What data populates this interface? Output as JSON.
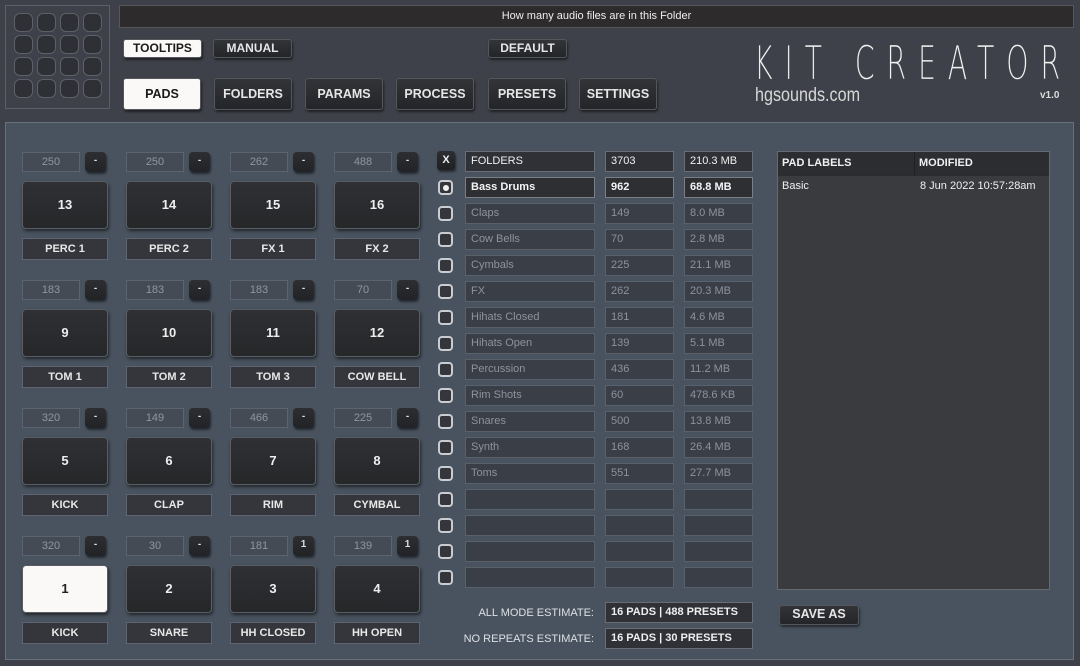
{
  "header": {
    "info_text": "How many audio files are in this Folder",
    "title": "KIT CREATOR",
    "site": "hgsounds.com",
    "version": "v1.0",
    "buttons": {
      "tooltips": "TOOLTIPS",
      "manual": "MANUAL",
      "default": "DEFAULT"
    },
    "tabs": [
      {
        "label": "PADS",
        "active": true
      },
      {
        "label": "FOLDERS",
        "active": false
      },
      {
        "label": "PARAMS",
        "active": false
      },
      {
        "label": "PROCESS",
        "active": false
      },
      {
        "label": "PRESETS",
        "active": false
      },
      {
        "label": "SETTINGS",
        "active": false
      }
    ]
  },
  "pads": [
    {
      "number": "13",
      "count": "250",
      "mode": "-",
      "label": "PERC 1"
    },
    {
      "number": "14",
      "count": "250",
      "mode": "-",
      "label": "PERC 2"
    },
    {
      "number": "15",
      "count": "262",
      "mode": "-",
      "label": "FX 1"
    },
    {
      "number": "16",
      "count": "488",
      "mode": "-",
      "label": "FX 2"
    },
    {
      "number": "9",
      "count": "183",
      "mode": "-",
      "label": "TOM 1"
    },
    {
      "number": "10",
      "count": "183",
      "mode": "-",
      "label": "TOM 2"
    },
    {
      "number": "11",
      "count": "183",
      "mode": "-",
      "label": "TOM 3"
    },
    {
      "number": "12",
      "count": "70",
      "mode": "-",
      "label": "COW BELL"
    },
    {
      "number": "5",
      "count": "320",
      "mode": "-",
      "label": "KICK"
    },
    {
      "number": "6",
      "count": "149",
      "mode": "-",
      "label": "CLAP"
    },
    {
      "number": "7",
      "count": "466",
      "mode": "-",
      "label": "RIM"
    },
    {
      "number": "8",
      "count": "225",
      "mode": "-",
      "label": "CYMBAL"
    },
    {
      "number": "1",
      "count": "320",
      "mode": "-",
      "label": "KICK",
      "active": true
    },
    {
      "number": "2",
      "count": "30",
      "mode": "-",
      "label": "SNARE"
    },
    {
      "number": "3",
      "count": "181",
      "mode": "1",
      "label": "HH CLOSED"
    },
    {
      "number": "4",
      "count": "139",
      "mode": "1",
      "label": "HH OPEN"
    }
  ],
  "folders": {
    "clear_label": "X",
    "header": {
      "name": "FOLDERS",
      "count": "3703",
      "size": "210.3 MB"
    },
    "rows": [
      {
        "name": "Bass Drums",
        "count": "962",
        "size": "68.8 MB",
        "selected": true
      },
      {
        "name": "Claps",
        "count": "149",
        "size": "8.0 MB"
      },
      {
        "name": "Cow Bells",
        "count": "70",
        "size": "2.8 MB"
      },
      {
        "name": "Cymbals",
        "count": "225",
        "size": "21.1 MB"
      },
      {
        "name": "FX",
        "count": "262",
        "size": "20.3 MB"
      },
      {
        "name": "Hihats Closed",
        "count": "181",
        "size": "4.6 MB"
      },
      {
        "name": "Hihats Open",
        "count": "139",
        "size": "5.1 MB"
      },
      {
        "name": "Percussion",
        "count": "436",
        "size": "11.2 MB"
      },
      {
        "name": "Rim Shots",
        "count": "60",
        "size": "478.6 KB"
      },
      {
        "name": "Snares",
        "count": "500",
        "size": "13.8 MB"
      },
      {
        "name": "Synth",
        "count": "168",
        "size": "26.4 MB"
      },
      {
        "name": "Toms",
        "count": "551",
        "size": "27.7 MB"
      },
      {
        "name": "",
        "count": "",
        "size": ""
      },
      {
        "name": "",
        "count": "",
        "size": ""
      },
      {
        "name": "",
        "count": "",
        "size": ""
      },
      {
        "name": "",
        "count": "",
        "size": ""
      }
    ],
    "estimates": [
      {
        "label": "ALL MODE ESTIMATE:",
        "value": "16 PADS | 488 PRESETS"
      },
      {
        "label": "NO REPEATS ESTIMATE:",
        "value": "16 PADS | 30 PRESETS"
      }
    ]
  },
  "pad_labels": {
    "columns": [
      "PAD LABELS",
      "MODIFIED"
    ],
    "rows": [
      {
        "name": "Basic",
        "modified": "8 Jun 2022 10:57:28am"
      }
    ],
    "save_as_label": "SAVE AS"
  }
}
